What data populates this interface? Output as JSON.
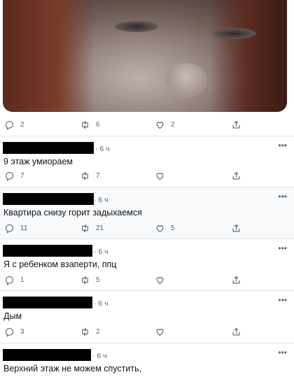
{
  "media": {
    "alt": ""
  },
  "top_post": {
    "replies": "2",
    "retweets": "6",
    "likes": "2"
  },
  "tweets": [
    {
      "time": "6 ч",
      "more": "•••",
      "text": "9 этаж умиораем",
      "replies": "7",
      "retweets": "7",
      "likes": ""
    },
    {
      "time": "6 ч",
      "more": "•••",
      "text": "Квартира снизу горит задыхаемся",
      "replies": "11",
      "retweets": "21",
      "likes": "5"
    },
    {
      "time": "6 ч",
      "more": "•••",
      "text": "Я с ребенком взаперти, ппц",
      "replies": "1",
      "retweets": "5",
      "likes": ""
    },
    {
      "time": "6 ч",
      "more": "•••",
      "text": "Дым",
      "replies": "3",
      "retweets": "2",
      "likes": ""
    },
    {
      "time": "6 ч",
      "more": "•••",
      "text": "Верхний этаж не можем спустить,",
      "replies": "",
      "retweets": "",
      "likes": ""
    }
  ],
  "icons": {
    "reply": "reply-icon",
    "retweet": "retweet-icon",
    "like": "heart-icon",
    "share": "share-icon",
    "more": "more-options-icon"
  }
}
